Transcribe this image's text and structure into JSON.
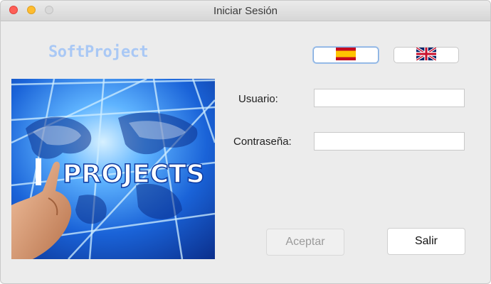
{
  "window": {
    "title": "Iniciar Sesión"
  },
  "brand": {
    "name": "SoftProject"
  },
  "languages": [
    {
      "id": "es",
      "icon": "spain-flag-icon",
      "selected": true
    },
    {
      "id": "en",
      "icon": "uk-flag-icon",
      "selected": false
    }
  ],
  "hero": {
    "word": "PROJECTS",
    "icon": "world-map-projects-image"
  },
  "form": {
    "user_label": "Usuario:",
    "user_value": "",
    "password_label": "Contraseña:",
    "password_value": ""
  },
  "buttons": {
    "accept_label": "Aceptar",
    "accept_enabled": false,
    "exit_label": "Salir"
  },
  "colors": {
    "brand_text": "#a9c8f5",
    "hero_blue": "#1a63d8",
    "close": "#fe5f57",
    "minimize": "#febc2e"
  }
}
